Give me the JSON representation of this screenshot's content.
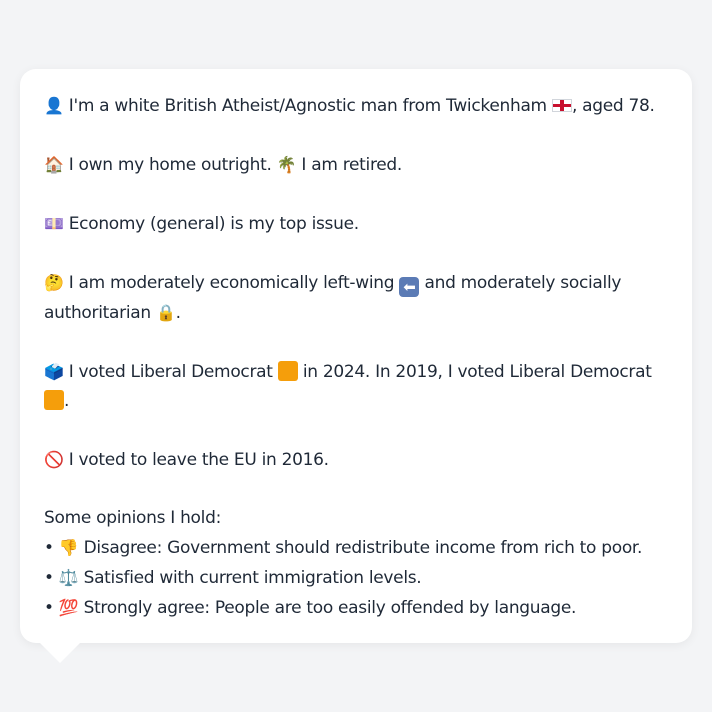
{
  "profile": {
    "line1": {
      "icon": "👤",
      "text_a": "I'm a white British Atheist/Agnostic man from Twickenham",
      "flag_icon": "england-flag",
      "text_b": ", aged 78."
    },
    "line2": {
      "icon": "🏠",
      "text_a": "I own my home outright.",
      "icon2": "🌴",
      "text_b": "I am retired."
    },
    "line3": {
      "icon": "💷",
      "text": "Economy (general) is my top issue."
    },
    "line4": {
      "icon": "🤔",
      "text_a": "I am moderately economically left-wing",
      "arrow_icon": "⬅",
      "text_b": "and moderately socially authoritarian",
      "lock_icon": "🔒",
      "text_c": "."
    },
    "line5": {
      "icon": "🗳️",
      "text_a": "I voted Liberal Democrat",
      "text_b": "in 2024. In 2019, I voted Liberal Democrat",
      "text_c": ".",
      "party_color": "#f59e0b"
    },
    "line6": {
      "icon": "🚫",
      "text": "I voted to leave the EU in 2016."
    },
    "opinions": {
      "heading": "Some opinions I hold:",
      "items": [
        {
          "bullet": "•",
          "icon": "👎",
          "text": "Disagree: Government should redistribute income from rich to poor."
        },
        {
          "bullet": "•",
          "icon": "⚖️",
          "text": "Satisfied with current immigration levels."
        },
        {
          "bullet": "•",
          "icon": "💯",
          "text": "Strongly agree: People are too easily offended by language."
        }
      ]
    }
  }
}
